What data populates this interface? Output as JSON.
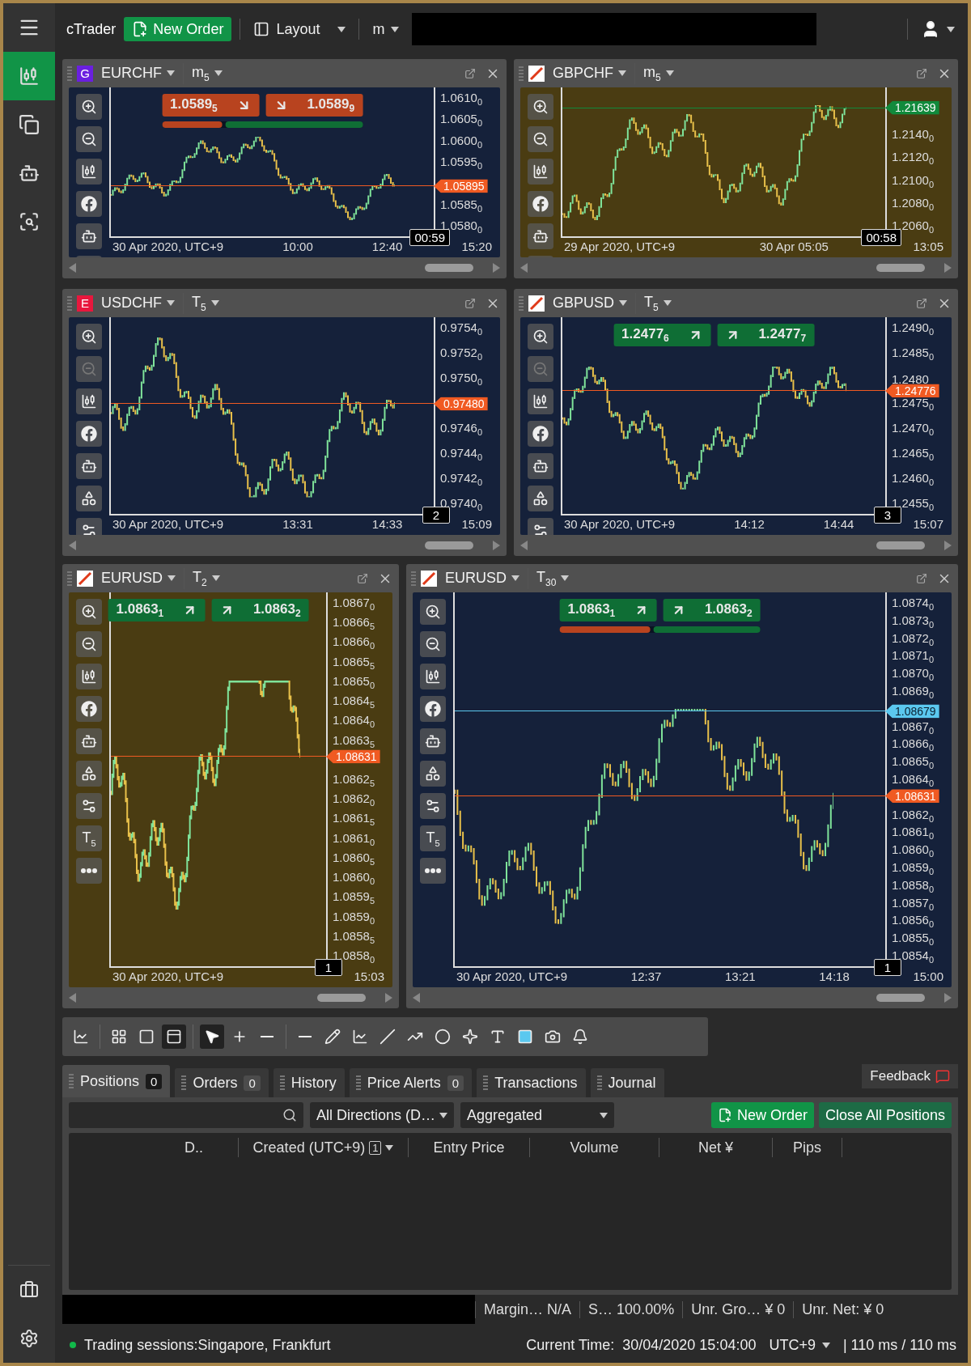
{
  "top_bar": {
    "app_name": "cTrader",
    "new_order": "New Order",
    "layout": "Layout",
    "symbol_mode": "m"
  },
  "sidebar": {
    "items": [
      {
        "selected": true
      },
      {
        "selected": false
      },
      {
        "selected": false
      },
      {
        "selected": false
      }
    ]
  },
  "chart_rows": [
    {
      "panels": [
        {
          "flag": {
            "kind": "letter",
            "letter": "G",
            "color": "#6a1fe0"
          },
          "symbol": "EURCHF",
          "timeframe": "m$_{5}$",
          "background": {
            "kind": "sky"
          },
          "zoom_out_disabled": false,
          "quotes": {
            "kind": "down",
            "bid": "1.0589$_{5}$",
            "ask": "1.0589$_{9}$",
            "sentiment": {
              "level": 0.3
            }
          },
          "axis": [
            "1.0610$_{0}$",
            "1.0605$_{0}$",
            "1.0600$_{0}$",
            "1.0595$_{0}$",
            "1.0585$_{0}$",
            "1.0580$_{0}$"
          ],
          "tags": [
            {
              "label": "1.05895",
              "color": "#f05a22"
            }
          ],
          "times": [
            "30 Apr 2020, UTC+9",
            "10:00",
            "12:40",
            "15:20"
          ],
          "countdown": "00:59"
        },
        {
          "flag": {
            "kind": "slash"
          },
          "symbol": "GBPCHF",
          "timeframe": "m$_{5}$",
          "background": {
            "kind": "tulips"
          },
          "zoom_out_disabled": false,
          "axis": [
            "1.2140$_{0}$",
            "1.2120$_{0}$",
            "1.2100$_{0}$",
            "1.2080$_{0}$",
            "1.2060$_{0}$"
          ],
          "tags": [
            {
              "label": "1.21639",
              "color": "#118a3c"
            }
          ],
          "times": [
            "29 Apr 2020, UTC+9",
            "30 Apr 05:05",
            "13:05"
          ],
          "countdown": "00:58"
        }
      ]
    },
    {
      "panels": [
        {
          "flag": {
            "kind": "letter",
            "letter": "E",
            "color": "#e8173d"
          },
          "symbol": "USDCHF",
          "timeframe": "T$_{5}$",
          "background": {
            "kind": "sky"
          },
          "zoom_out_disabled": true,
          "axis": [
            "0.9754$_{0}$",
            "0.9752$_{0}$",
            "0.9750$_{0}$",
            "0.9746$_{0}$",
            "0.9744$_{0}$",
            "0.9742$_{0}$",
            "0.9740$_{0}$"
          ],
          "tags": [
            {
              "label": "0.97480",
              "color": "#f05a22"
            }
          ],
          "times": [
            "30 Apr 2020, UTC+9",
            "13:31",
            "14:33",
            "15:09"
          ],
          "countdown": "2"
        },
        {
          "flag": {
            "kind": "slash"
          },
          "symbol": "GBPUSD",
          "timeframe": "T$_{5}$",
          "background": {
            "kind": "sky"
          },
          "zoom_out_disabled": true,
          "quotes": {
            "kind": "up",
            "bid": "1.2477$_{6}$",
            "ask": "1.2477$_{7}$"
          },
          "axis": [
            "1.2490$_{0}$",
            "1.2485$_{0}$",
            "1.2480",
            "1.2475$_{0}$",
            "1.2470$_{0}$",
            "1.2465$_{0}$",
            "1.2460$_{0}$",
            "1.2455$_{0}$"
          ],
          "tags": [
            {
              "label": "1.24776",
              "color": "#f05a22"
            }
          ],
          "times": [
            "30 Apr 2020, UTC+9",
            "14:12",
            "14:44",
            "15:07"
          ],
          "countdown": "3"
        }
      ]
    },
    {
      "panels": [
        {
          "flag": {
            "kind": "slash"
          },
          "symbol": "EURUSD",
          "timeframe": "T$_{2}$",
          "background": {
            "kind": "tulips"
          },
          "zoom_out_disabled": false,
          "tool_timeframe": "T$_{5}$",
          "quotes": {
            "kind": "up",
            "bid": "1.0863$_{1}$",
            "ask": "1.0863$_{2}$"
          },
          "axis": [
            "1.0867$_{0}$",
            "1.0866$_{5}$",
            "1.0866$_{0}$",
            "1.0865$_{5}$",
            "1.0865$_{0}$",
            "1.0864$_{5}$",
            "1.0864$_{0}$",
            "1.0863$_{5}$",
            "1.0862$_{5}$",
            "1.0862$_{0}$",
            "1.0861$_{5}$",
            "1.0861$_{0}$",
            "1.0860$_{5}$",
            "1.0860$_{0}$",
            "1.0859$_{5}$",
            "1.0859$_{0}$",
            "1.0858$_{5}$",
            "1.0858$_{0}$"
          ],
          "tags": [
            {
              "label": "1.08631",
              "color": "#f05a22"
            }
          ],
          "times": [
            "30 Apr 2020, UTC+9",
            "15:03"
          ],
          "countdown": "1"
        },
        {
          "flag": {
            "kind": "slash"
          },
          "symbol": "EURUSD",
          "timeframe": "T$_{30}$",
          "background": {
            "kind": "sky"
          },
          "zoom_out_disabled": false,
          "tool_timeframe": "T$_{5}$",
          "quotes": {
            "kind": "up",
            "bid": "1.0863$_{1}$",
            "ask": "1.0863$_{2}$",
            "sentiment": {
              "level": 0.45
            }
          },
          "axis": [
            "1.0874$_{0}$",
            "1.0873$_{0}$",
            "1.0872$_{0}$",
            "1.0871$_{0}$",
            "1.0870$_{0}$",
            "1.0869$_{0}$",
            "1.0867$_{0}$",
            "1.0866$_{0}$",
            "1.0865$_{0}$",
            "1.0864$_{0}$",
            "1.0862$_{0}$",
            "1.0861$_{0}$",
            "1.0860$_{0}$",
            "1.0859$_{0}$",
            "1.0858$_{0}$",
            "1.0857$_{0}$",
            "1.0856$_{0}$",
            "1.0855$_{0}$",
            "1.0854$_{0}$"
          ],
          "tags": [
            {
              "label": "1.08679",
              "color": "#5bc8ef"
            },
            {
              "label": "1.08631",
              "color": "#f05a22"
            }
          ],
          "times": [
            "30 Apr 2020, UTC+9",
            "12:37",
            "13:21",
            "14:18",
            "15:00"
          ],
          "countdown": "1"
        }
      ]
    }
  ],
  "drawing_toolbar": {
    "layouts": [
      {
        "selected": false
      },
      {
        "selected": false
      },
      {
        "selected": true
      }
    ],
    "pointers": [
      {
        "selected": true
      },
      {
        "selected": false
      },
      {
        "selected": false
      }
    ]
  },
  "bottom_tabs": [
    {
      "label": "Positions",
      "count": "0",
      "selected": true
    },
    {
      "label": "Orders",
      "count": "0",
      "selected": false
    },
    {
      "label": "History",
      "selected": false
    },
    {
      "label": "Price Alerts",
      "count": "0",
      "selected": false
    },
    {
      "label": "Transactions",
      "selected": false
    },
    {
      "label": "Journal",
      "selected": false
    }
  ],
  "feedback": "Feedback",
  "filters": {
    "direction": "All Directions (D…",
    "grouping": "Aggregated"
  },
  "actions": {
    "new_order": "New Order",
    "close_all": "Close All Positions"
  },
  "table": {
    "columns": [
      {
        "label": "D..",
        "sorted": false
      },
      {
        "label": "Created (UTC+9)",
        "badge": "1",
        "sorted": true
      },
      {
        "label": "Entry Price",
        "sorted": false
      },
      {
        "label": "Volume",
        "sorted": false
      },
      {
        "label": "Net ¥",
        "sorted": false
      },
      {
        "label": "Pips",
        "sorted": false
      }
    ]
  },
  "summary": [
    {
      "label": "Margin…",
      "value": "N/A"
    },
    {
      "label": "S…",
      "value": "100.00%"
    },
    {
      "label": "Unr. Gro…",
      "value": "¥ 0"
    },
    {
      "label": "Unr. Net:",
      "value": "¥ 0"
    }
  ],
  "status_bar": {
    "sessions": "Trading sessions:Singapore, Frankfurt",
    "time_label": "Current Time:",
    "time": "30/04/2020 15:04:00",
    "timezone": "UTC+9",
    "latency": "| 110 ms / 110 ms"
  }
}
